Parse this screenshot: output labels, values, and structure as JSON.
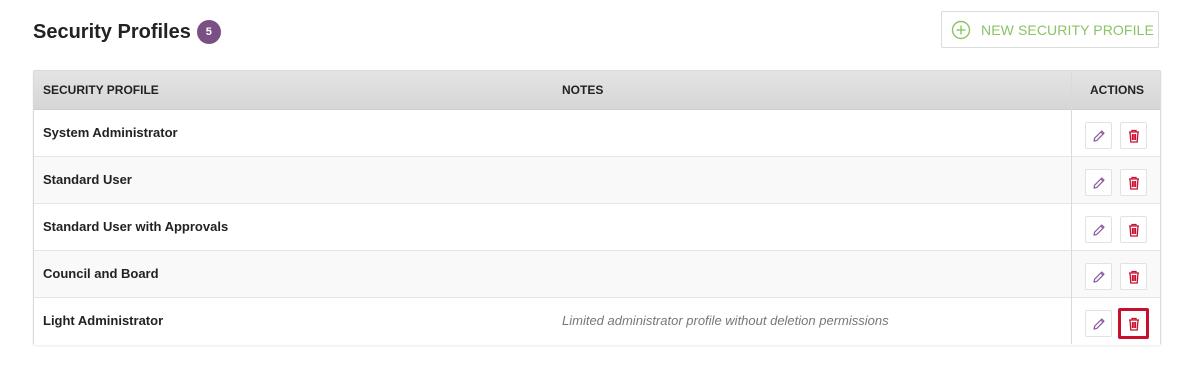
{
  "header": {
    "title": "Security Profiles",
    "count": "5"
  },
  "toolbar": {
    "new_label": "NEW SECURITY PROFILE"
  },
  "table": {
    "columns": {
      "profile": "SECURITY PROFILE",
      "notes": "NOTES",
      "actions": "ACTIONS"
    },
    "rows": [
      {
        "name": "System Administrator",
        "notes": ""
      },
      {
        "name": "Standard User",
        "notes": ""
      },
      {
        "name": "Standard User with Approvals",
        "notes": ""
      },
      {
        "name": "Council and Board",
        "notes": ""
      },
      {
        "name": "Light Administrator",
        "notes": "Limited administrator profile without deletion permissions"
      }
    ]
  },
  "icons": {
    "add": "plus-circle-icon",
    "edit": "pencil-icon",
    "delete": "trash-icon"
  },
  "colors": {
    "accent_green": "#8cc463",
    "badge_purple": "#7a4f84",
    "edit_purple": "#8a5a9a",
    "delete_red": "#c8102e"
  }
}
